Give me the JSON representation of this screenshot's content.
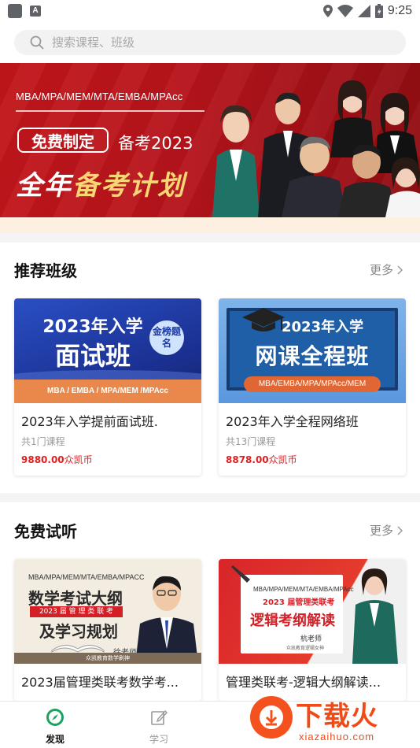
{
  "status_bar": {
    "time": "9:25",
    "app_letter": "A"
  },
  "search": {
    "placeholder": "搜索课程、班级"
  },
  "banner": {
    "programs": "MBA/MPA/MEM/MTA/EMBA/MPAcc",
    "tag": "免费制定",
    "year_text": "备考2023",
    "headline_a": "全年",
    "headline_b": "备考计划"
  },
  "recommended": {
    "title": "推荐班级",
    "more": "更多",
    "cards": [
      {
        "thumb_line1": "2023年入学",
        "thumb_line2": "面试班",
        "thumb_badge": "金榜题名",
        "thumb_bar": "MBA / EMBA / MPA/MEM /MPAcc",
        "title": "2023年入学提前面试班.",
        "count": "共1门课程",
        "price": "9880.00",
        "currency": "众凯币"
      },
      {
        "thumb_line1": "2023年入学",
        "thumb_line2": "网课全程班",
        "thumb_bar": "MBA/EMBA/MPA/MPAcc/MEM",
        "title": "2023年入学全程网络班",
        "count": "共13门课程",
        "price": "8878.00",
        "currency": "众凯币"
      }
    ]
  },
  "free_trial": {
    "title": "免费试听",
    "more": "更多",
    "cards": [
      {
        "thumb_sub": "MBA/MPA/MEM/MTA/EMBA/MPACC",
        "thumb_line1": "数学考试大纲",
        "thumb_red": "2023 届 管 理 类 联 考",
        "thumb_line2": "及学习规划",
        "thumb_teacher": "徐老师",
        "thumb_foot": "众凯教育数学刷神",
        "title": "2023届管理类联考数学考..."
      },
      {
        "thumb_sub": "MBA/MPA/MEM/MTA/EMBA/MPAcc",
        "thumb_red": "2023 届管理类联考",
        "thumb_line1": "逻辑考纲解读",
        "thumb_teacher": "杭老师",
        "thumb_foot": "众凯教育逻辑女神",
        "title": "管理类联考-逻辑大纲解读..."
      }
    ]
  },
  "tabbar": {
    "tabs": [
      {
        "label": "发现",
        "active": true
      },
      {
        "label": "学习",
        "active": false
      }
    ]
  },
  "watermark": {
    "text": "下载火",
    "url": "xiazaihuo.com"
  },
  "colors": {
    "brand_red": "#c2161a",
    "price_red": "#e02020",
    "active_tab": "#1aa260"
  }
}
